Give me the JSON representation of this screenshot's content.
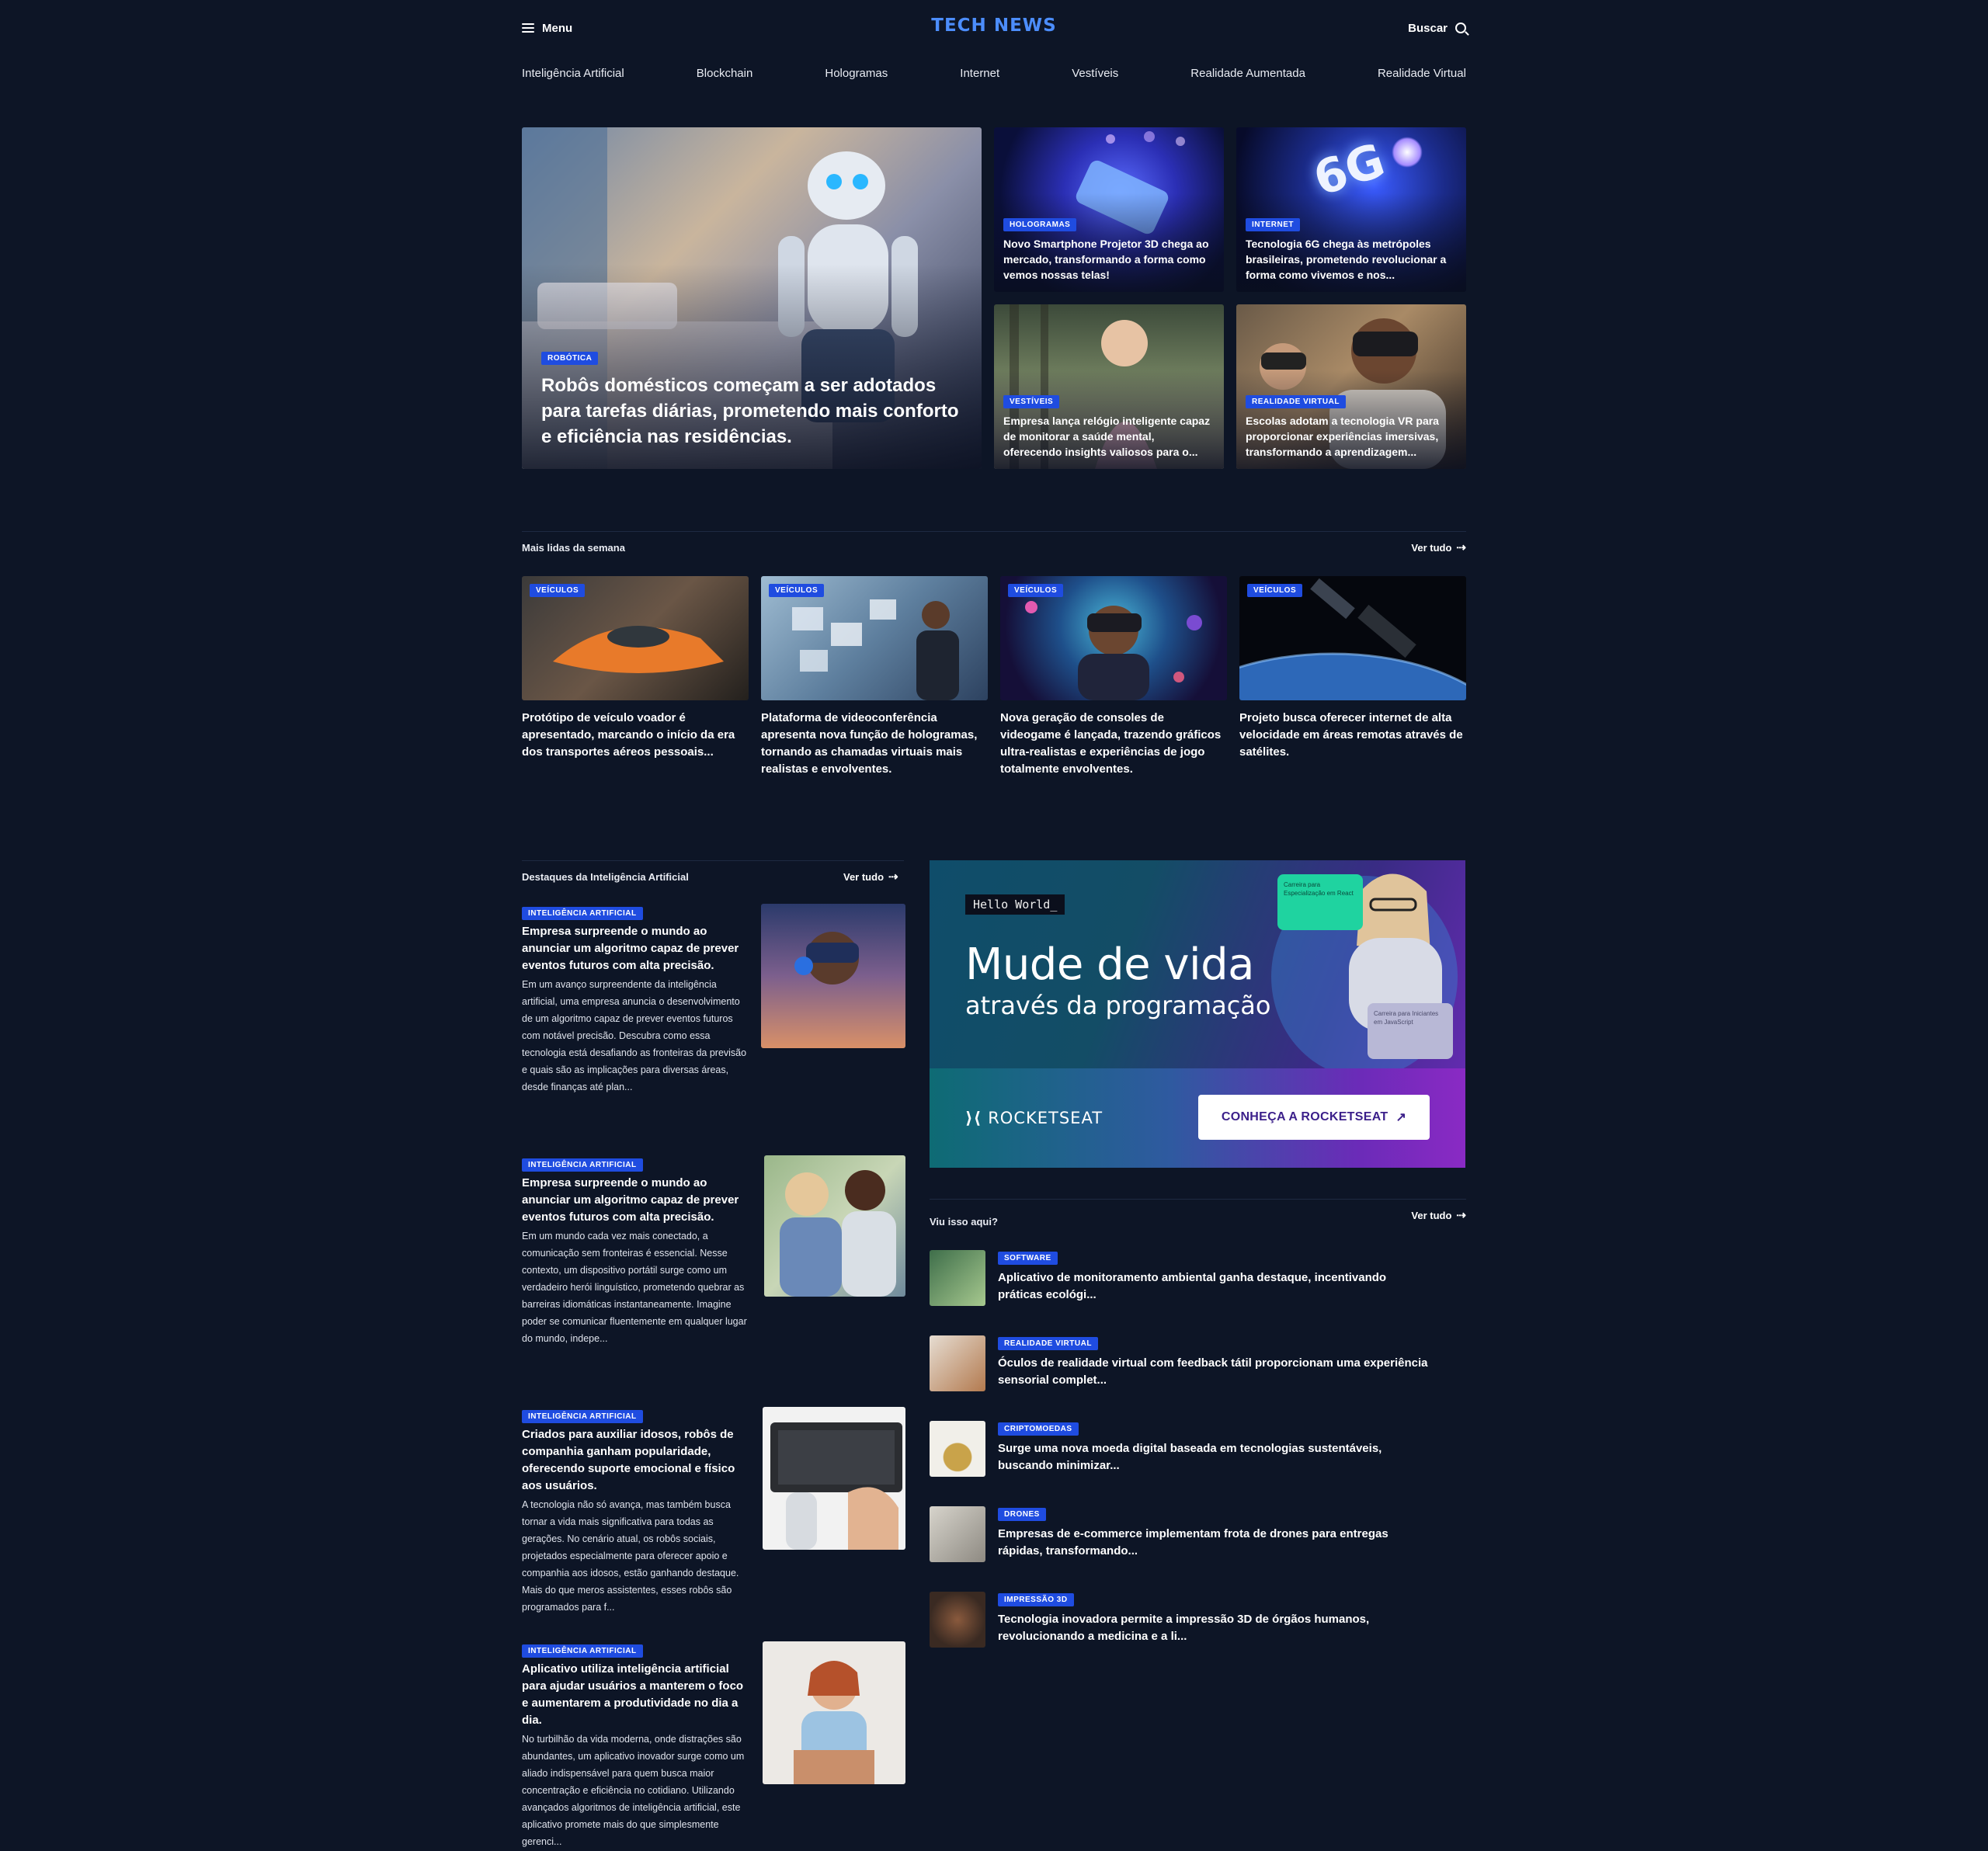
{
  "header": {
    "menu_label": "Menu",
    "logo": "TECH NEWS",
    "search_label": "Buscar"
  },
  "nav": [
    "Inteligência Artificial",
    "Blockchain",
    "Hologramas",
    "Internet",
    "Vestíveis",
    "Realidade Aumentada",
    "Realidade Virtual"
  ],
  "hero": {
    "main": {
      "category": "ROBÓTICA",
      "title": "Robôs domésticos começam a ser adotados para tarefas diárias, prometendo mais conforto e eficiência nas residências."
    },
    "side": [
      {
        "category": "HOLOGRAMAS",
        "title": "Novo Smartphone Projetor 3D chega ao mercado, transformando a forma como vemos nossas telas!"
      },
      {
        "category": "INTERNET",
        "title": "Tecnologia 6G chega às metrópoles brasileiras, prometendo revolucionar a forma como vivemos e nos..."
      },
      {
        "category": "VESTÍVEIS",
        "title": "Empresa lança relógio inteligente capaz de monitorar a saúde mental, oferecendo insights valiosos para o..."
      },
      {
        "category": "REALIDADE VIRTUAL",
        "title": "Escolas adotam a tecnologia VR para proporcionar experiências imersivas, transformando a aprendizagem..."
      }
    ],
    "sixg_text": "6G"
  },
  "most_read": {
    "title": "Mais lidas da semana",
    "see_all": "Ver tudo",
    "items": [
      {
        "category": "VEÍCULOS",
        "title": "Protótipo de veículo voador é apresentado, marcando o início da era dos transportes aéreos pessoais..."
      },
      {
        "category": "VEÍCULOS",
        "title": "Plataforma de videoconferência apresenta nova função de hologramas, tornando as chamadas virtuais mais realistas e envolventes."
      },
      {
        "category": "VEÍCULOS",
        "title": "Nova geração de consoles de videogame é lançada, trazendo gráficos ultra-realistas e experiências de jogo totalmente envolventes."
      },
      {
        "category": "VEÍCULOS",
        "title": "Projeto busca oferecer internet de alta velocidade em áreas remotas através de satélites."
      }
    ]
  },
  "ai_section": {
    "title": "Destaques da Inteligência Artificial",
    "see_all": "Ver tudo",
    "items": [
      {
        "category": "INTELIGÊNCIA ARTIFICIAL",
        "title": "Empresa surpreende o mundo ao anunciar um algoritmo capaz de prever eventos futuros com alta precisão.",
        "desc": "Em um avanço surpreendente da inteligência artificial, uma empresa anuncia o desenvolvimento de um algoritmo capaz de prever eventos futuros com notável precisão. Descubra como essa tecnologia está desafiando as fronteiras da previsão e quais são as implicações para diversas áreas, desde finanças até plan..."
      },
      {
        "category": "INTELIGÊNCIA ARTIFICIAL",
        "title": "Empresa surpreende o mundo ao anunciar um algoritmo capaz de prever eventos futuros com alta precisão.",
        "desc": "Em um mundo cada vez mais conectado, a comunicação sem fronteiras é essencial. Nesse contexto, um dispositivo portátil surge como um verdadeiro herói linguístico, prometendo quebrar as barreiras idiomáticas instantaneamente. Imagine poder se comunicar fluentemente em qualquer lugar do mundo, indepe..."
      },
      {
        "category": "INTELIGÊNCIA ARTIFICIAL",
        "title": "Criados para auxiliar idosos, robôs de companhia ganham popularidade, oferecendo suporte emocional e físico aos usuários.",
        "desc": "A tecnologia não só avança, mas também busca tornar a vida mais significativa para todas as gerações. No cenário atual, os robôs sociais, projetados especialmente para oferecer apoio e companhia aos idosos, estão ganhando destaque. Mais do que meros assistentes, esses robôs são programados para f..."
      },
      {
        "category": "INTELIGÊNCIA ARTIFICIAL",
        "title": "Aplicativo utiliza inteligência artificial para ajudar usuários a manterem o foco e aumentarem a produtividade no dia a dia.",
        "desc": "No turbilhão da vida moderna, onde distrações são abundantes, um aplicativo inovador surge como um aliado indispensável para quem busca maior concentração e eficiência no cotidiano. Utilizando avançados algoritmos de inteligência artificial, este aplicativo promete mais do que simplesmente gerenci..."
      }
    ]
  },
  "ad": {
    "hello": "Hello World_",
    "headline": "Mude de vida",
    "subheadline": "através da programação",
    "brand": "ROCKETSEAT",
    "cta": "CONHEÇA A ROCKETSEAT",
    "chip1": "Carreira para Especialização em React",
    "chip2": "Carreira para Iniciantes em JavaScript"
  },
  "seen": {
    "title": "Viu isso aqui?",
    "see_all": "Ver tudo",
    "items": [
      {
        "category": "SOFTWARE",
        "title": "Aplicativo de monitoramento ambiental ganha destaque, incentivando práticas ecológi..."
      },
      {
        "category": "REALIDADE VIRTUAL",
        "title": "Óculos de realidade virtual com feedback tátil proporcionam uma experiência sensorial complet..."
      },
      {
        "category": "CRIPTOMOEDAS",
        "title": "Surge uma nova moeda digital baseada em tecnologias sustentáveis, buscando minimizar..."
      },
      {
        "category": "DRONES",
        "title": "Empresas de e-commerce implementam frota de drones para entregas rápidas, transformando..."
      },
      {
        "category": "IMPRESSÃO 3D",
        "title": "Tecnologia inovadora permite a impressão 3D de órgãos humanos, revolucionando a medicina e a li..."
      }
    ]
  },
  "colors": {
    "background": "#0d1526",
    "accent": "#4c8dfb",
    "badge": "#1f4ce0"
  }
}
